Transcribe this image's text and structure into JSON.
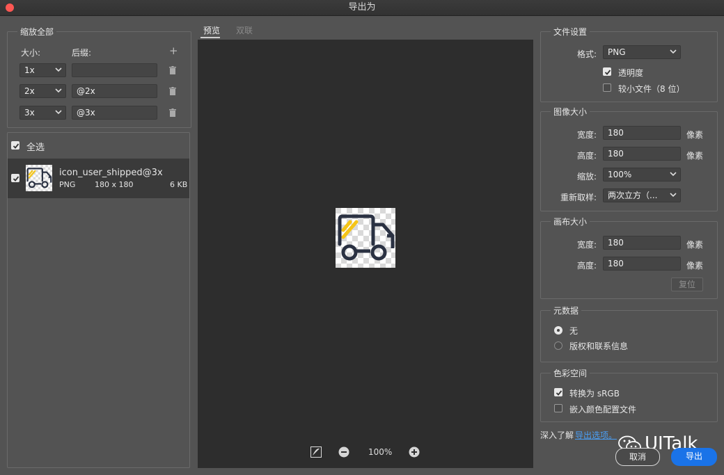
{
  "window": {
    "title": "导出为"
  },
  "scale_group": {
    "legend": "缩放全部",
    "size_label": "大小:",
    "suffix_label": "后缀:",
    "add_symbol": "+",
    "rows": [
      {
        "size": "1x",
        "suffix": ""
      },
      {
        "size": "2x",
        "suffix": "@2x"
      },
      {
        "size": "3x",
        "suffix": "@3x"
      }
    ]
  },
  "asset_list": {
    "select_all_label": "全选",
    "select_all_checked": true,
    "items": [
      {
        "name": "icon_user_shipped@3x",
        "format": "PNG",
        "dimensions": "180 x 180",
        "size": "6 KB",
        "checked": true
      }
    ]
  },
  "preview": {
    "tabs": [
      {
        "label": "预览",
        "active": true
      },
      {
        "label": "双联",
        "active": false
      }
    ],
    "zoom_level": "100%"
  },
  "file_settings": {
    "legend": "文件设置",
    "format_label": "格式:",
    "format_value": "PNG",
    "transparency_label": "透明度",
    "transparency_checked": true,
    "smaller_file_label": "较小文件（8 位）",
    "smaller_file_checked": false
  },
  "image_size": {
    "legend": "图像大小",
    "width_label": "宽度:",
    "width_value": "180",
    "height_label": "高度:",
    "height_value": "180",
    "unit": "像素",
    "scale_label": "缩放:",
    "scale_value": "100%",
    "resample_label": "重新取样:",
    "resample_value": "两次立方（..."
  },
  "canvas_size": {
    "legend": "画布大小",
    "width_label": "宽度:",
    "width_value": "180",
    "height_label": "高度:",
    "height_value": "180",
    "unit": "像素",
    "reset_label": "复位"
  },
  "metadata": {
    "legend": "元数据",
    "options": [
      {
        "label": "无",
        "selected": true
      },
      {
        "label": "版权和联系信息",
        "selected": false
      }
    ]
  },
  "color_space": {
    "legend": "色彩空间",
    "convert_label": "转换为 sRGB",
    "convert_checked": true,
    "embed_label": "嵌入颜色配置文件",
    "embed_checked": false
  },
  "footer": {
    "learn_more_label": "深入了解",
    "learn_more_link": "导出选项。",
    "watermark_text": "UITalk",
    "cancel_label": "取消",
    "export_label": "导出"
  },
  "colors": {
    "accent": "#1a73e8",
    "link": "#4a9ff5",
    "truck_dark": "#2a3142",
    "truck_yellow": "#f5c518"
  }
}
